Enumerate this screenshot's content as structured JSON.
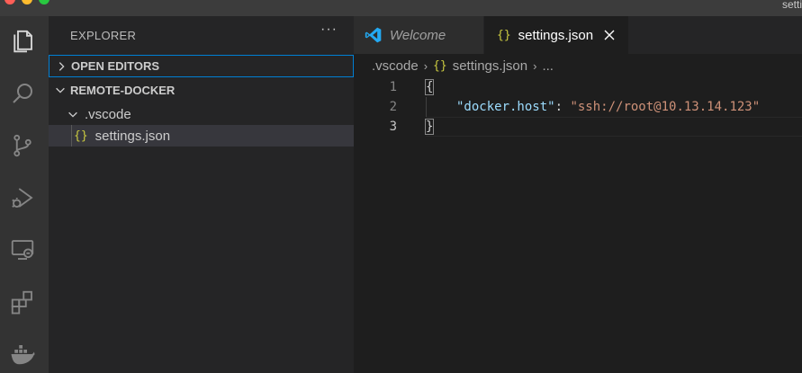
{
  "window": {
    "title": "setti"
  },
  "activity_bar": {
    "items": [
      {
        "icon": "files-icon",
        "label": "Explorer"
      },
      {
        "icon": "search-icon",
        "label": "Search"
      },
      {
        "icon": "source-control-icon",
        "label": "Source Control"
      },
      {
        "icon": "run-debug-icon",
        "label": "Run and Debug"
      },
      {
        "icon": "remote-explorer-icon",
        "label": "Remote Explorer"
      },
      {
        "icon": "extensions-icon",
        "label": "Extensions"
      },
      {
        "icon": "docker-icon",
        "label": "Docker"
      }
    ]
  },
  "sidebar": {
    "title": "EXPLORER",
    "more_label": "···",
    "sections": [
      {
        "label": "OPEN EDITORS",
        "expanded": false
      },
      {
        "label": "REMOTE-DOCKER",
        "expanded": true
      }
    ],
    "tree": [
      {
        "label": ".vscode",
        "type": "folder",
        "expanded": true
      },
      {
        "label": "settings.json",
        "type": "file",
        "icon": "{}",
        "selected": true
      }
    ]
  },
  "tabs": [
    {
      "label": "Welcome",
      "active": false,
      "icon": "vscode-logo-icon"
    },
    {
      "label": "settings.json",
      "active": true,
      "icon": "{}"
    }
  ],
  "breadcrumb": {
    "items": [
      ".vscode",
      "settings.json",
      "..."
    ],
    "file_icon": "{}"
  },
  "editor": {
    "lines": [
      {
        "number": "1",
        "open": "{"
      },
      {
        "number": "2",
        "key": "\"docker.host\"",
        "colon": ": ",
        "value": "\"ssh://root@10.13.14.123\""
      },
      {
        "number": "3",
        "close": "}"
      }
    ]
  },
  "colors": {
    "accent": "#007fd4",
    "json_icon": "#cbcb41",
    "key": "#9cdcfe",
    "string": "#ce9178"
  }
}
